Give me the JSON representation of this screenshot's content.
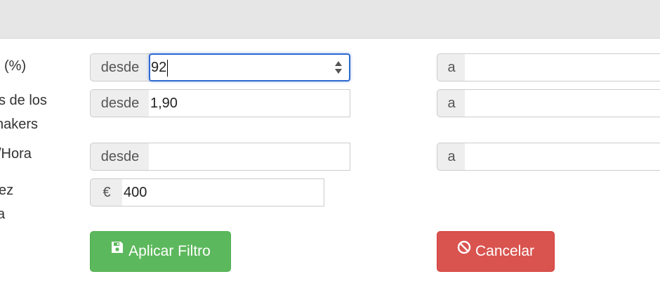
{
  "labels": {
    "row1": "(%)",
    "row2_line1": "s de los",
    "row2_line2": "nakers",
    "row3": "/Hora",
    "row4_line1": "ez",
    "row4_line2": "a"
  },
  "addons": {
    "from": "desde",
    "to": "a",
    "currency": "€"
  },
  "fields": {
    "row1_from": "92",
    "row1_to": "",
    "row2_from": "1,90",
    "row2_to": "",
    "row3_from": "",
    "row3_to": "",
    "row4_amount": "400"
  },
  "buttons": {
    "apply_label": "Aplicar Filtro",
    "apply_icon": "save-icon",
    "cancel_label": "Cancelar",
    "cancel_icon": "ban-icon"
  },
  "colors": {
    "apply": "#5cb85c",
    "cancel": "#d9534f",
    "focus": "#2e6ad1"
  }
}
